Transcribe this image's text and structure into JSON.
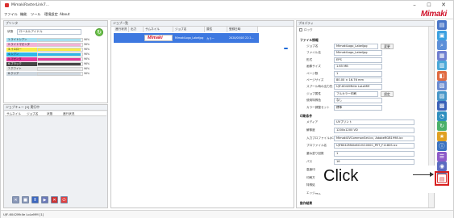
{
  "window": {
    "title": "MimakiRasterLink7...",
    "brand": "Mimaki",
    "controls": {
      "minimize": "–",
      "maximize": "☐",
      "close": "✕"
    }
  },
  "menu": [
    {
      "label": "ファイル"
    },
    {
      "label": "機能"
    },
    {
      "label": "ツール"
    },
    {
      "label": "環境設定"
    },
    {
      "label": "About"
    }
  ],
  "ink_panel": {
    "header": "プリンタ",
    "status_label": "状態",
    "status_value": "ローカルアイドル",
    "inks": [
      {
        "name": "1.ライトシアン",
        "level": 0.96,
        "color": "#a7dff0",
        "pct": "96%"
      },
      {
        "name": "2.ライトマゼンタ",
        "level": 0.96,
        "color": "#f2b3d6",
        "pct": "96%"
      },
      {
        "name": "3.イエロー",
        "level": 0.96,
        "color": "#f7ec4a",
        "pct": "96%"
      },
      {
        "name": "4.シアン",
        "level": 0.96,
        "color": "#2fb8e8",
        "pct": "96%"
      },
      {
        "name": "5.マゼンタ",
        "level": 0.96,
        "color": "#e23a9a",
        "pct": "96%"
      },
      {
        "name": "6.ブラック",
        "level": 0.96,
        "color": "#444444",
        "pct": "96%"
      },
      {
        "name": "7.ホワイト",
        "level": 0.96,
        "color": "#e6e6e6",
        "pct": "96%"
      },
      {
        "name": "8.クリア",
        "level": 0.96,
        "color": "#cfd8e0",
        "pct": "96%"
      }
    ]
  },
  "queue_panel": {
    "header": "ジョブキュー [0] 実行中",
    "columns": [
      "サムネイル",
      "ジョブ名",
      "状態",
      "進行状況"
    ]
  },
  "job_list": {
    "header": "ジョブ一覧",
    "columns": [
      "進行状況",
      "出力",
      "サムネイル",
      "ジョブ名",
      "属性",
      "登録日時"
    ],
    "row": {
      "thumb_text": "Mimaki",
      "name": "MimakiLogo_Labeljpg",
      "attr": "カラー",
      "date": "2020/05/03 22:2..."
    }
  },
  "properties": {
    "header": "プロパティ",
    "lock_label": "ロック",
    "file_info_title": "ファイル情報",
    "rows": [
      {
        "label": "ジョブ名",
        "value": "MimakiLogo_Labeljpg",
        "button": "変更"
      },
      {
        "label": "ファイル名",
        "value": "MimakiLogo_Labeljpg"
      },
      {
        "label": "形式",
        "value": "EPS"
      },
      {
        "label": "画像サイズ",
        "value": "1.65 MB"
      },
      {
        "label": "ページ数",
        "value": "1"
      },
      {
        "label": "ページサイズ",
        "value": "80.00 × 16.76 mm"
      },
      {
        "label": "スプール時の出力先",
        "value": "UJF-6042MkIIe LoLeMM"
      },
      {
        "label": "ジョブ属性",
        "value": "フルカラー印刷",
        "button": "設定"
      },
      {
        "label": "使用特殊色",
        "value": "なし"
      },
      {
        "label": "カラー調整セット",
        "value": "標準"
      }
    ],
    "print_title": "印刷条件",
    "print_rows": [
      {
        "label": "メディア",
        "value": "UVプリント"
      },
      {
        "label": "解像度",
        "value": "1200x1200 VD"
      },
      {
        "label": "入力プロファイル(ICC)",
        "value": "MimakiUVCommonSet.icc, AdobeRGB1998.icc"
      },
      {
        "label": "プロファイル名",
        "value": "UJF6042MkIIe6CUV1000C_PET_F1180S.icc"
      },
      {
        "label": "重ね塗り回数",
        "value": "1"
      },
      {
        "label": "パス",
        "value": "16"
      },
      {
        "label": "高速印刷",
        "value": ""
      },
      {
        "label": "印刷方向",
        "value": ""
      },
      {
        "label": "特殊処理",
        "value": ""
      },
      {
        "label": "エッジ補正",
        "value": ""
      }
    ],
    "last_section": "動作結果"
  },
  "side_icons": [
    {
      "name": "properties-icon",
      "color": "#4a76c8",
      "glyph": "▤"
    },
    {
      "name": "image-edit-icon",
      "color": "#3aa0e0",
      "glyph": "▣"
    },
    {
      "name": "search-icon",
      "color": "#5c8fd8",
      "glyph": "⌕"
    },
    {
      "name": "print-icon",
      "color": "#6f7fd0",
      "glyph": "▦"
    },
    {
      "name": "layout-icon",
      "color": "#4aa8d8",
      "glyph": "▥"
    },
    {
      "name": "color-icon",
      "color": "#e06a40",
      "glyph": "◧"
    },
    {
      "name": "cut-icon",
      "color": "#6a8bd0",
      "glyph": "▧"
    },
    {
      "name": "special-icon",
      "color": "#4696c8",
      "glyph": "▨"
    },
    {
      "name": "tile-icon",
      "color": "#3a62b8",
      "glyph": "▩"
    },
    {
      "name": "gauge-icon",
      "color": "#2e8fbf",
      "glyph": "◔"
    },
    {
      "name": "rotate-icon",
      "color": "#4ab06a",
      "glyph": "↻"
    },
    {
      "name": "star-icon",
      "color": "#e0a020",
      "glyph": "★"
    },
    {
      "name": "info-icon",
      "color": "#3a72c0",
      "glyph": "ⓘ"
    },
    {
      "name": "list-icon",
      "color": "#8c5ac8",
      "glyph": "☰"
    },
    {
      "name": "camera-icon",
      "color": "#5a6ac0",
      "glyph": "◉"
    },
    {
      "name": "sheet-icon",
      "color": "#3a82c8",
      "glyph": "▤"
    },
    {
      "name": "highlighted-icon",
      "color": "#d83a3a",
      "glyph": "▤"
    }
  ],
  "tool_buttons": [
    {
      "name": "delete-job-button",
      "color": "#8a98b8",
      "glyph": "✕"
    },
    {
      "name": "cancel-button",
      "color": "#8a98b8",
      "glyph": "■"
    },
    {
      "name": "pause-button",
      "color": "#3a66c0",
      "glyph": "Ⅱ"
    },
    {
      "name": "resume-button",
      "color": "#6a78b8",
      "glyph": "▶"
    },
    {
      "name": "stop-button",
      "color": "#cc3333",
      "glyph": "✕"
    },
    {
      "name": "power-button",
      "color": "#e04040",
      "glyph": "⏻"
    }
  ],
  "status_bar": {
    "text": "UJF-6042MkIIe LoLeMM [1]"
  },
  "callout": {
    "text": "Click"
  }
}
